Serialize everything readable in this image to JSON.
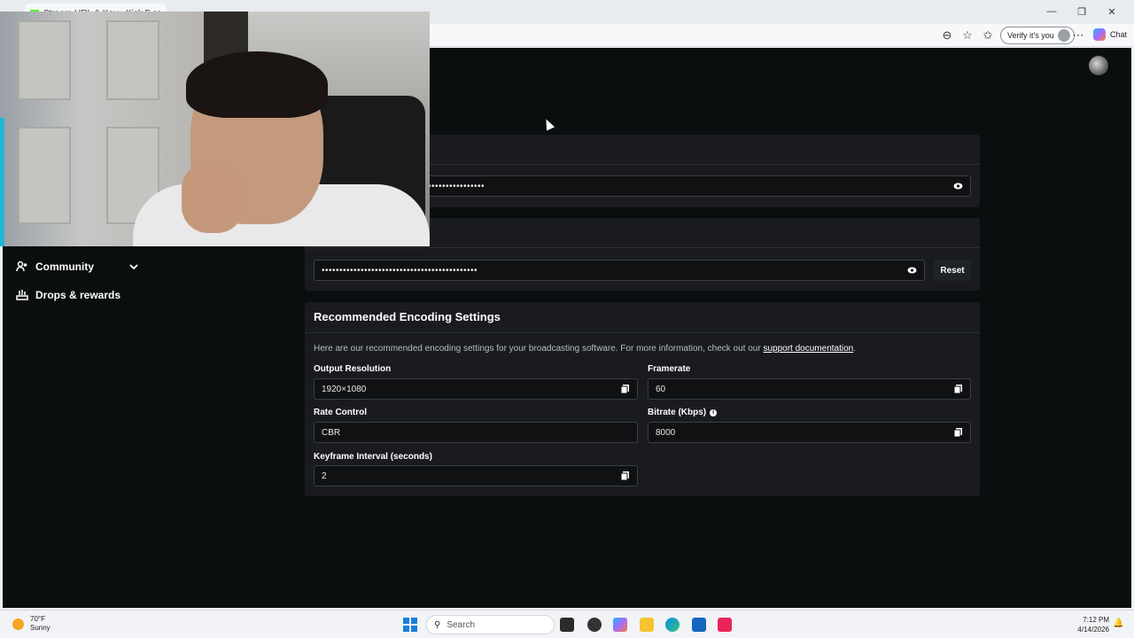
{
  "browser": {
    "tab_title": "Stream URL & Key - Kick Dashbo",
    "verify_label": "Verify it's you",
    "chat_label": "Chat"
  },
  "sidebar": {
    "items": [
      {
        "label": "Community",
        "icon": "community-icon"
      },
      {
        "label": "Drops & rewards",
        "icon": "drops-rewards-icon"
      }
    ]
  },
  "stream": {
    "url_masked": "••••••••••••••••",
    "key_masked": "••••••••••••••••••••••••••••••••••••••••••••",
    "reset_label": "Reset"
  },
  "encoding": {
    "title": "Recommended Encoding Settings",
    "description": "Here are our recommended encoding settings for your broadcasting software. For more information, check out our",
    "link_text": "support documentation",
    "description_end": ".",
    "fields": {
      "output_resolution": {
        "label": "Output Resolution",
        "value": "1920×1080"
      },
      "framerate": {
        "label": "Framerate",
        "value": "60"
      },
      "rate_control": {
        "label": "Rate Control",
        "value": "CBR"
      },
      "bitrate": {
        "label": "Bitrate (Kbps)",
        "value": "8000"
      },
      "keyframe_interval": {
        "label": "Keyframe Interval (seconds)",
        "value": "2"
      }
    }
  },
  "taskbar": {
    "weather_temp": "70°F",
    "weather_desc": "Sunny",
    "search_placeholder": "Search",
    "time": "7:12 PM",
    "date": "4/14/2026"
  },
  "colors": {
    "page_bg": "#0b0e0f",
    "panel_bg": "#191b1f",
    "kick_green": "#53fc18"
  }
}
